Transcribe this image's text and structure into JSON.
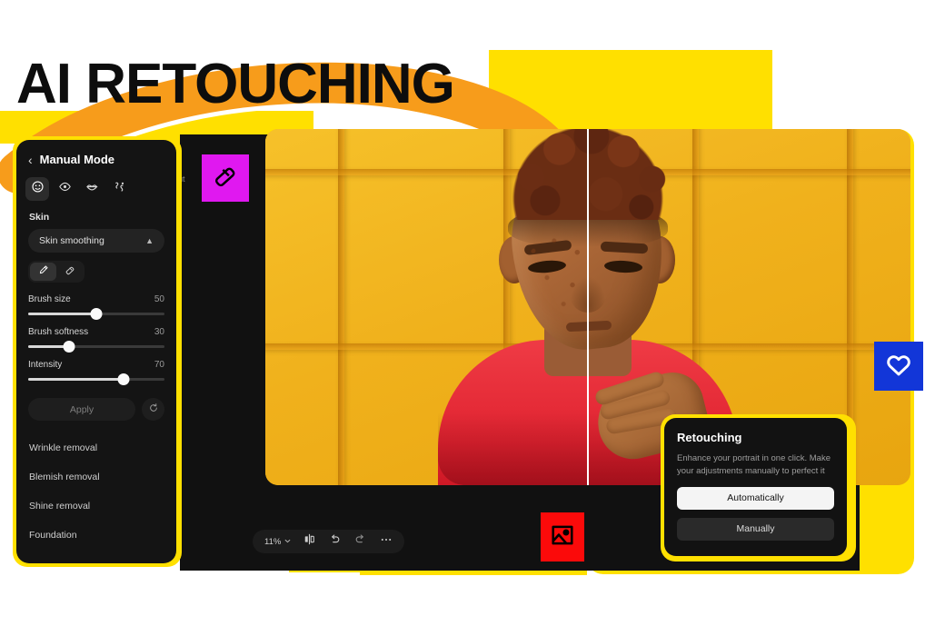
{
  "headline": "AI RETOUCHING",
  "panel": {
    "back_icon": "chevron-left-icon",
    "title": "Manual Mode",
    "tools": [
      {
        "name": "face-icon",
        "label": "Face",
        "active": true
      },
      {
        "name": "eye-icon",
        "label": "Eyes",
        "active": false
      },
      {
        "name": "lips-icon",
        "label": "Lips",
        "active": false
      },
      {
        "name": "body-icon",
        "label": "Body",
        "active": false
      }
    ],
    "section_label": "Skin",
    "select": {
      "value": "Skin smoothing",
      "chevron": "chevron-up-icon"
    },
    "brush_tools": [
      {
        "name": "pencil-icon",
        "label": "Brush",
        "active": true
      },
      {
        "name": "eraser-icon",
        "label": "Eraser",
        "active": false
      }
    ],
    "sliders": [
      {
        "label": "Brush size",
        "value": 50,
        "max": 100
      },
      {
        "label": "Brush softness",
        "value": 30,
        "max": 100
      },
      {
        "label": "Intensity",
        "value": 70,
        "max": 100
      }
    ],
    "apply_label": "Apply",
    "reset_icon": "reset-icon",
    "list": [
      "Wrinkle removal",
      "Blemish removal",
      "Shine removal",
      "Foundation"
    ],
    "ghost_tab": "ut"
  },
  "toolbar": {
    "zoom_level": "11%",
    "zoom_chevron": "chevron-down-icon",
    "compare_icon": "compare-split-icon",
    "undo_icon": "undo-icon",
    "redo_icon": "redo-icon",
    "more_icon": "more-options-icon"
  },
  "card": {
    "title": "Retouching",
    "description": "Enhance your portrait in one click. Make your adjustments manually to perfect it",
    "primary_label": "Automatically",
    "secondary_label": "Manually"
  },
  "badges": [
    {
      "name": "eraser-badge",
      "icon": "eraser-icon",
      "color": "#e018f0"
    },
    {
      "name": "heart-badge",
      "icon": "heart-icon",
      "color": "#1236d8"
    },
    {
      "name": "image-badge",
      "icon": "image-icon",
      "color": "#fb0a0a"
    }
  ],
  "colors": {
    "accent_yellow": "#ffe000",
    "accent_orange": "#f79c1b",
    "panel_bg": "#141414",
    "canvas_bg": "#111111",
    "magenta": "#e018f0",
    "blue": "#1236d8",
    "red": "#fb0a0a"
  },
  "canvas": {
    "image_alt": "Before and after portrait of a young man with curly hair in a red hoodie against a yellow background"
  }
}
